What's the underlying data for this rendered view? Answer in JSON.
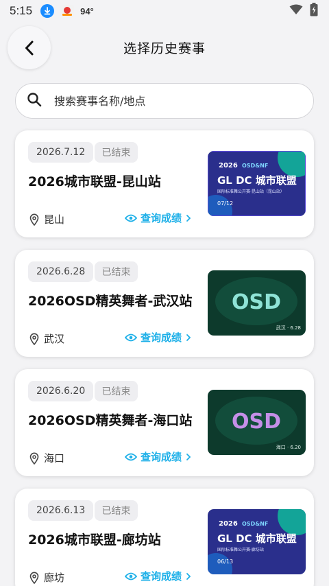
{
  "status_bar": {
    "time": "5:15",
    "temperature": "94°"
  },
  "header": {
    "title": "选择历史赛事"
  },
  "search": {
    "placeholder": "搜索赛事名称/地点"
  },
  "colors": {
    "accent": "#1eb0e8",
    "chip_bg": "#eeeef1",
    "page_bg": "#f3f3f5"
  },
  "events": [
    {
      "date": "2026.7.12",
      "status": "已结束",
      "title": "2026城市联盟-昆山站",
      "location": "昆山",
      "action": "查询成绩",
      "poster": {
        "kind": "gldc",
        "year": "2026",
        "logo": "OSD&NF",
        "headline": "GL DC 城市联盟",
        "subtitle": "国际标准舞公开赛·昆山站（昆山站）",
        "footer": "07/12"
      }
    },
    {
      "date": "2026.6.28",
      "status": "已结束",
      "title": "2026OSD精英舞者-武汉站",
      "location": "武汉",
      "action": "查询成绩",
      "poster": {
        "kind": "osd",
        "headline": "OSD",
        "caption": "武汉 · 6.28"
      }
    },
    {
      "date": "2026.6.20",
      "status": "已结束",
      "title": "2026OSD精英舞者-海口站",
      "location": "海口",
      "action": "查询成绩",
      "poster": {
        "kind": "osd",
        "headline": "OSD",
        "caption": "海口 · 6.20"
      }
    },
    {
      "date": "2026.6.13",
      "status": "已结束",
      "title": "2026城市联盟-廊坊站",
      "location": "廊坊",
      "action": "查询成绩",
      "poster": {
        "kind": "gldc",
        "year": "2026",
        "logo": "OSD&NF",
        "headline": "GL DC 城市联盟",
        "subtitle": "国际标准舞公开赛·廊坊站",
        "footer": "06/13"
      }
    }
  ]
}
